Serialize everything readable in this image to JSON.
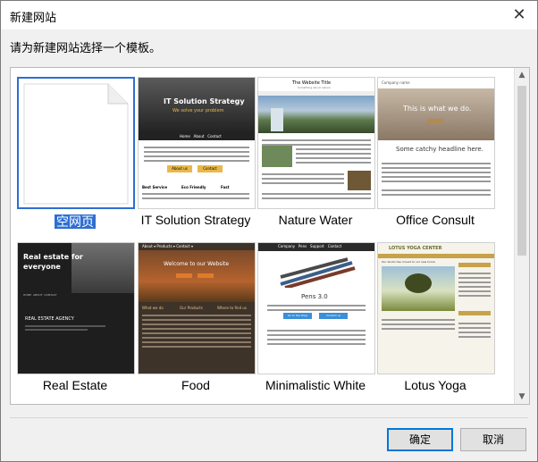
{
  "window": {
    "title": "新建网站"
  },
  "prompt": "请为新建网站选择一个模板。",
  "templates": [
    {
      "name": "空网页"
    },
    {
      "name": "IT Solution Strategy",
      "hero": "IT Solution Strategy",
      "sub": "We solve your problem",
      "nav": [
        "Home",
        "About",
        "Contact"
      ],
      "btn1": "About us",
      "btn2": "Contact",
      "cols": [
        "Best Service",
        "Eco Friendly",
        "Fast"
      ]
    },
    {
      "name": "Nature Water",
      "title": "The Website Title",
      "sub": "Something about nature"
    },
    {
      "name": "Office Consult",
      "company": "Company name",
      "hero": "This is what we do.",
      "headline": "Some catchy headline here."
    },
    {
      "name": "Real Estate",
      "hero": "Real estate for everyone",
      "agency": "REAL ESTATE AGENCY",
      "nav": [
        "HOME",
        "ABOUT",
        "CONTACT"
      ]
    },
    {
      "name": "Food",
      "nav": "About ▾   Products ▾   Contact ▾",
      "hero": "Welcome to our Website",
      "cols": [
        "What we do",
        "Our Products",
        "Where to find us"
      ]
    },
    {
      "name": "Minimalistic White",
      "nav": [
        "Company",
        "Pens",
        "Support",
        "Contact"
      ],
      "product": "Pens 3.0",
      "btn1": "Go to the Shop",
      "btn2": "Contact us"
    },
    {
      "name": "Lotus Yoga",
      "brand": "LOTUS YOGA CENTER",
      "headline": "Our studio has moved to our new home"
    }
  ],
  "buttons": {
    "ok": "确定",
    "cancel": "取消"
  },
  "colors": {
    "accent": "#2e6fd1",
    "gold": "#e8b84a",
    "olive": "#c8a24a"
  }
}
